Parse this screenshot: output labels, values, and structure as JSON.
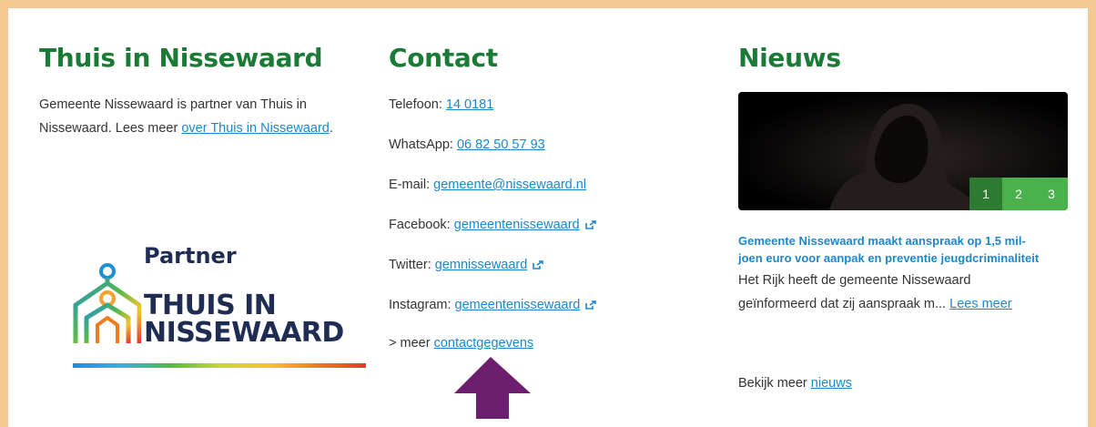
{
  "col_thuis": {
    "heading": "Thuis in Nissewaard",
    "text_line1": "Gemeente Nissewaard is partner van Thuis in",
    "text_line2_prefix": "Nissewaard. Lees meer ",
    "link": "over Thuis in Nissewaard",
    "text_line2_suffix": ".",
    "partner_label": "Partner",
    "logo_line1": "THUIS IN",
    "logo_line2": "NISSEWAARD"
  },
  "col_contact": {
    "heading": "Contact",
    "items": [
      {
        "label": "Telefoon: ",
        "link": "14 0181",
        "external": false
      },
      {
        "label": "WhatsApp: ",
        "link": "06 82 50 57 93",
        "external": false
      },
      {
        "label": "E-mail: ",
        "link": "gemeente@nissewaard.nl",
        "external": false
      },
      {
        "label": "Facebook: ",
        "link": "gemeentenissewaard",
        "external": true
      },
      {
        "label": "Twitter: ",
        "link": "gemnissewaard",
        "external": true
      },
      {
        "label": "Instagram: ",
        "link": "gemeentenissewaard",
        "external": true
      }
    ],
    "more_prefix": "> meer ",
    "more_link": "contactgegevens"
  },
  "col_news": {
    "heading": "Nieuws",
    "pager": [
      "1",
      "2",
      "3"
    ],
    "active_page": 0,
    "title_line1": "Gemeente Nissewaard maakt aanspraak op 1,5 mil-",
    "title_line2": "joen euro voor aanpak en preventie jeugdcriminaliteit",
    "body_line1": "Het Rijk heeft de gemeente Nissewaard",
    "body_line2_prefix": "geïnformeerd dat zij aanspraak m... ",
    "read_more": "Lees meer",
    "more_prefix": "Bekijk meer ",
    "more_link": "nieuws"
  },
  "colors": {
    "frame": "#f6c993",
    "heading": "#1a7a36",
    "link": "#1d87c9",
    "pager": "#4bb14a",
    "pager_active": "#2d7b32",
    "arrow": "#6b1f6e"
  }
}
